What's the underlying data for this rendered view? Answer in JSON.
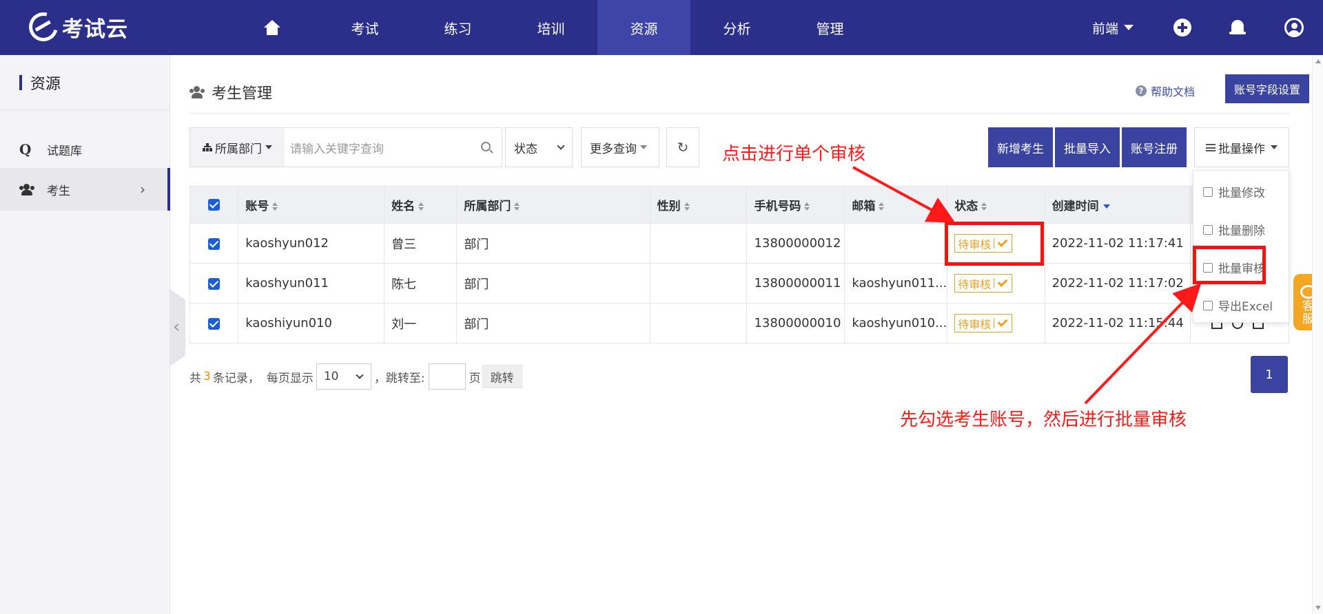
{
  "app": {
    "logo_text": "考试云"
  },
  "nav": {
    "items": [
      "考试",
      "练习",
      "培训",
      "资源",
      "分析",
      "管理"
    ],
    "active": "资源",
    "user_menu": "前端"
  },
  "sidebar": {
    "title": "资源",
    "items": [
      {
        "label": "试题库",
        "icon": "q-icon"
      },
      {
        "label": "考生",
        "icon": "users-icon",
        "active": true
      }
    ]
  },
  "page": {
    "title": "考生管理",
    "help_link": "帮助文档",
    "field_settings_button": "账号字段设置"
  },
  "filters": {
    "department": "所属部门",
    "search_placeholder": "请输入关键字查询",
    "status": "状态",
    "more": "更多查询",
    "reset_icon": "↻"
  },
  "actions": {
    "add": "新增考生",
    "import": "批量导入",
    "register": "账号注册",
    "batch": "批量操作"
  },
  "batch_menu": [
    "批量修改",
    "批量删除",
    "批量审核",
    "导出Excel"
  ],
  "table": {
    "columns": [
      "账号",
      "姓名",
      "所属部门",
      "性别",
      "手机号码",
      "邮箱",
      "状态",
      "创建时间"
    ],
    "rows": [
      {
        "account": "kaoshyun012",
        "name": "曾三",
        "dept": "部门",
        "gender": "",
        "phone": "13800000012",
        "email": "",
        "status": "待审核",
        "created": "2022-11-02 11:17:41"
      },
      {
        "account": "kaoshyun011",
        "name": "陈七",
        "dept": "部门",
        "gender": "",
        "phone": "13800000011",
        "email": "kaoshyun011...",
        "status": "待审核",
        "created": "2022-11-02 11:17:02"
      },
      {
        "account": "kaoshiyun010",
        "name": "刘一",
        "dept": "部门",
        "gender": "",
        "phone": "13800000010",
        "email": "kaoshyun010...",
        "status": "待审核",
        "created": "2022-11-02 11:15:44"
      }
    ]
  },
  "pagination": {
    "prefix": "共",
    "total": "3",
    "suffix": "条记录，",
    "per_page_label": "每页显示",
    "per_page": "10",
    "jump_label": "，跳转至:",
    "page_unit": "页",
    "jump_button": "跳转",
    "current_page": "1"
  },
  "annotations": {
    "single": "点击进行单个审核",
    "batch": "先勾选考生账号，然后进行批量审核"
  },
  "service": {
    "label_1": "客",
    "label_2": "服"
  },
  "colors": {
    "primary": "#2b2f8a",
    "button": "#3b43a0",
    "pending": "#f0a020",
    "annotation": "#ff1a1a",
    "checkbox": "#1a5fd8"
  }
}
